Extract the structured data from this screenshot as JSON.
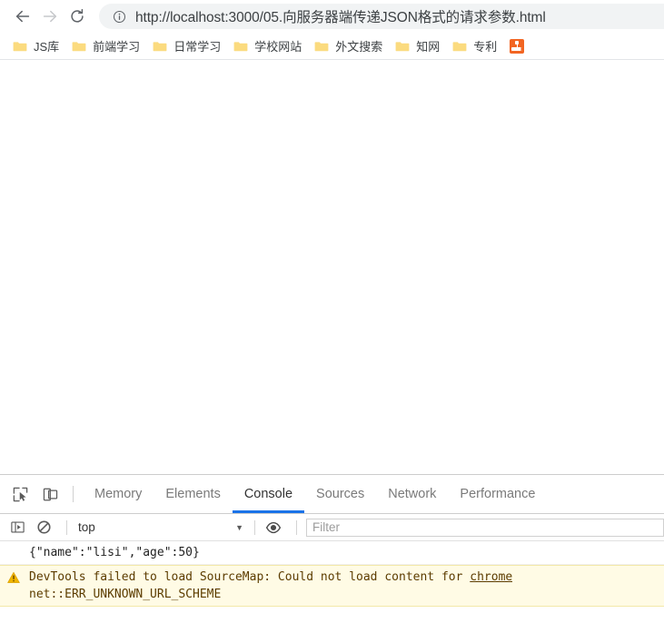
{
  "browser": {
    "nav": {
      "back_title": "Back",
      "forward_title": "Forward",
      "reload_title": "Reload"
    },
    "omnibox": {
      "url": "http://localhost:3000/05.向服务器端传递JSON格式的请求参数.html",
      "site_info_icon": "info-circle-icon"
    },
    "bookmarks": [
      {
        "label": "JS库",
        "icon": "folder-icon"
      },
      {
        "label": "前端学习",
        "icon": "folder-icon"
      },
      {
        "label": "日常学习",
        "icon": "folder-icon"
      },
      {
        "label": "学校网站",
        "icon": "folder-icon"
      },
      {
        "label": "外文搜索",
        "icon": "folder-icon"
      },
      {
        "label": "知网",
        "icon": "folder-icon"
      },
      {
        "label": "专利",
        "icon": "folder-icon"
      },
      {
        "label": "",
        "icon": "xmind-app-icon"
      }
    ]
  },
  "devtools": {
    "inspect_icon": "inspect-element-icon",
    "device_toolbar_icon": "device-toolbar-icon",
    "tabs": [
      {
        "label": "Memory",
        "active": false
      },
      {
        "label": "Elements",
        "active": false
      },
      {
        "label": "Console",
        "active": true
      },
      {
        "label": "Sources",
        "active": false
      },
      {
        "label": "Network",
        "active": false
      },
      {
        "label": "Performance",
        "active": false
      }
    ],
    "console_toolbar": {
      "sidebar_icon": "console-sidebar-icon",
      "clear_icon": "clear-console-icon",
      "context": "top",
      "context_caret": "▼",
      "live_expression_icon": "eye-icon",
      "filter_placeholder": "Filter",
      "filter_value": ""
    },
    "messages": [
      {
        "type": "log",
        "text": "{\"name\":\"lisi\",\"age\":50}"
      },
      {
        "type": "warning",
        "icon": "warning-triangle-icon",
        "text_before_link": "DevTools failed to load SourceMap: Could not load content for ",
        "link_text": "chrome",
        "text_after": "\nnet::ERR_UNKNOWN_URL_SCHEME"
      }
    ]
  },
  "colors": {
    "accent_blue": "#1a73e8",
    "warning_bg": "#fffbe5",
    "warning_icon": "#f0b400",
    "omnibox_bg": "#f1f3f4",
    "folder_icon": "#fbdb7f",
    "app_icon": "#f26522"
  }
}
